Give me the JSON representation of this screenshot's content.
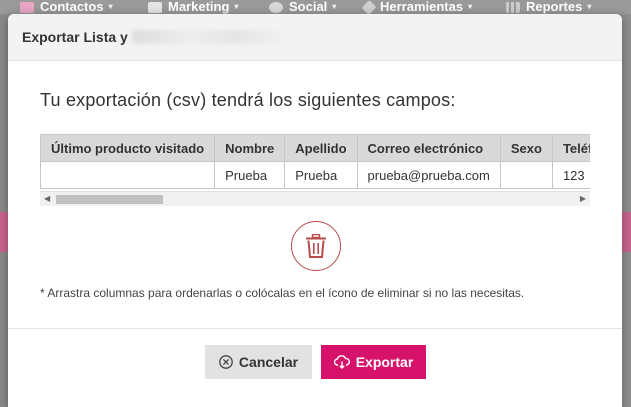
{
  "topnav": {
    "items": [
      {
        "label": "Contactos",
        "icon": "contacts-icon"
      },
      {
        "label": "Marketing",
        "icon": "marketing-icon"
      },
      {
        "label": "Social",
        "icon": "social-icon"
      },
      {
        "label": "Herramientas",
        "icon": "wrench-icon"
      },
      {
        "label": "Reportes",
        "icon": "bar-chart-icon"
      }
    ],
    "caret": "▾"
  },
  "modal": {
    "title": "Exportar Lista y",
    "lead": "Tu exportación (csv) tendrá los siguientes campos:",
    "table": {
      "headers": [
        "Último producto visitado",
        "Nombre",
        "Apellido",
        "Correo electrónico",
        "Sexo",
        "Teléfono"
      ],
      "rows": [
        [
          "",
          "Prueba",
          "Prueba",
          "prueba@prueba.com",
          "",
          "123"
        ]
      ]
    },
    "scroll_left": "◀",
    "scroll_right": "▶",
    "hint": "* Arrastra columnas para ordenarlas o colócalas en el ícono de eliminar si no las necesitas.",
    "buttons": {
      "cancel": "Cancelar",
      "export": "Exportar"
    }
  },
  "colors": {
    "accent": "#d6126b",
    "trash": "#b94b4b",
    "header_bg": "#d9d9d9"
  }
}
